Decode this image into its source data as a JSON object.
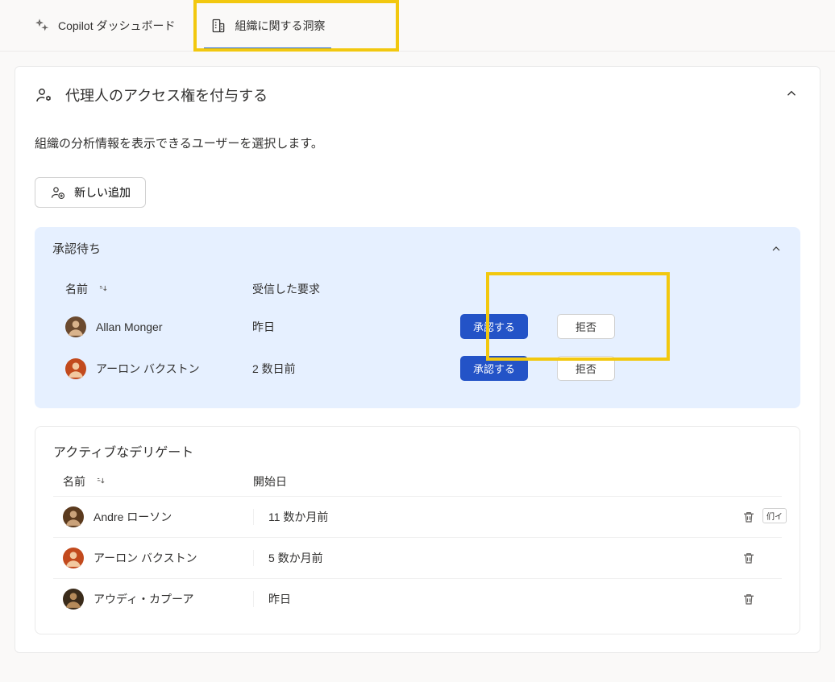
{
  "tabs": {
    "copilot_label": "Copilot ダッシュボード",
    "org_insights_label": "組織に関する洞察"
  },
  "card": {
    "title": "代理人のアクセス権を付与する",
    "description": "組織の分析情報を表示できるユーザーを選択します。",
    "add_new_label": "新しい追加"
  },
  "pending": {
    "title": "承認待ち",
    "headers": {
      "name": "名前",
      "request": "受信した要求"
    },
    "approve_label": "承認する",
    "reject_label": "拒否",
    "rows": [
      {
        "name": "Allan Monger",
        "when": "昨日",
        "avatar_color": "#6b4a2f"
      },
      {
        "name": "アーロン バクストン",
        "when": "2 数日前",
        "avatar_color": "#c24a1d"
      }
    ]
  },
  "active": {
    "title": "アクティブなデリゲート",
    "headers": {
      "name": "名前",
      "start": "開始日"
    },
    "delete_tooltip": "们イ",
    "rows": [
      {
        "name": "Andre ローソン",
        "when": "11 数か月前",
        "avatar_color": "#5b3a1e",
        "show_tooltip": true
      },
      {
        "name": "アーロン バクストン",
        "when": "5 数か月前",
        "avatar_color": "#c24a1d",
        "show_tooltip": false
      },
      {
        "name": "アウディ・カプーア",
        "when": "昨日",
        "avatar_color": "#3a2b1a",
        "show_tooltip": false
      }
    ]
  }
}
